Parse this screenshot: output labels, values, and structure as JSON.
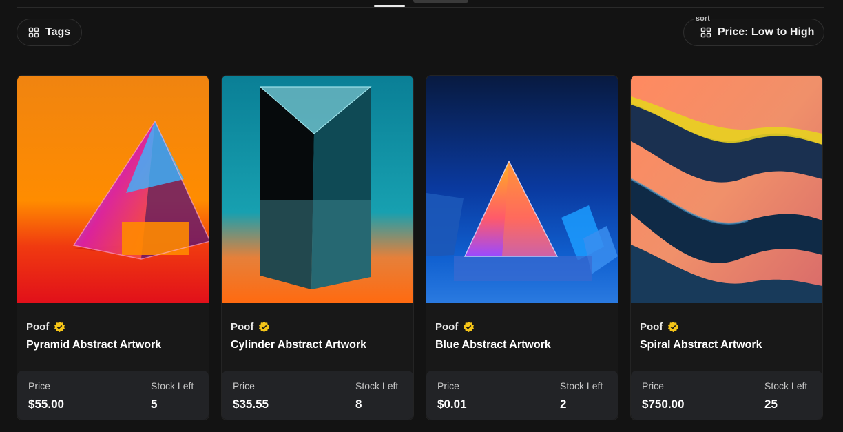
{
  "filters": {
    "tags_label": "Tags",
    "sort_caption": "sort",
    "sort_value": "Price: Low to High"
  },
  "icons": {
    "filter": "grid-icon",
    "verified": "verified-badge-icon"
  },
  "colors": {
    "background": "#131313",
    "card": "#181818",
    "footer": "#222326",
    "badge": "#f5c518"
  },
  "cards": [
    {
      "creator": "Poof",
      "title": "Pyramid Abstract Artwork",
      "price_label": "Price",
      "price": "$55.00",
      "stock_label": "Stock Left",
      "stock": "5"
    },
    {
      "creator": "Poof",
      "title": "Cylinder Abstract Artwork",
      "price_label": "Price",
      "price": "$35.55",
      "stock_label": "Stock Left",
      "stock": "8"
    },
    {
      "creator": "Poof",
      "title": "Blue Abstract Artwork",
      "price_label": "Price",
      "price": "$0.01",
      "stock_label": "Stock Left",
      "stock": "2"
    },
    {
      "creator": "Poof",
      "title": "Spiral Abstract Artwork",
      "price_label": "Price",
      "price": "$750.00",
      "stock_label": "Stock Left",
      "stock": "25"
    }
  ]
}
